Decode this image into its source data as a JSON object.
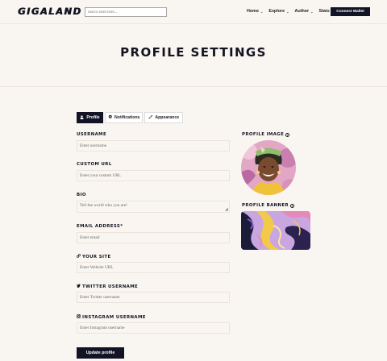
{
  "header": {
    "logo": "GIGALAND",
    "search": {
      "placeholder": "search item here..."
    },
    "nav": [
      {
        "label": "Home",
        "icon": "chevron-down-icon"
      },
      {
        "label": "Explore",
        "icon": "chevron-down-icon"
      },
      {
        "label": "Author",
        "icon": "chevron-down-icon"
      },
      {
        "label": "Stats",
        "icon": "chevron-down-icon"
      }
    ],
    "wallet_button": "Connect Wallet"
  },
  "page_title": "PROFILE SETTINGS",
  "tabs": [
    {
      "label": "Profile",
      "icon": "user-icon",
      "active": true
    },
    {
      "label": "Notifications",
      "icon": "gear-icon",
      "active": false
    },
    {
      "label": "Appearance",
      "icon": "brush-icon",
      "active": false
    }
  ],
  "form": {
    "username": {
      "label": "USERNAME",
      "placeholder": "Enter username"
    },
    "custom_url": {
      "label": "CUSTOM URL",
      "placeholder": "Enter your custom URL"
    },
    "bio": {
      "label": "BIO",
      "placeholder": "Tell the world who you are!"
    },
    "email": {
      "label": "EMAIL ADDRESS*",
      "placeholder": "Enter email"
    },
    "site": {
      "label": "YOUR SITE",
      "icon": "link-icon",
      "placeholder": "Enter Website URL"
    },
    "twitter": {
      "label": "TWITTER USERNAME",
      "icon": "twitter-icon",
      "placeholder": "Enter Twitter username"
    },
    "instagram": {
      "label": "INSTAGRAM USERNAME",
      "icon": "instagram-icon",
      "placeholder": "Enter Instagram username"
    },
    "submit": "Update profile"
  },
  "sidebar": {
    "profile_image_label": "PROFILE IMAGE",
    "profile_banner_label": "PROFILE BANNER"
  },
  "colors": {
    "background": "#f9f6f2",
    "primary": "#131326",
    "border": "#ede2dc"
  }
}
